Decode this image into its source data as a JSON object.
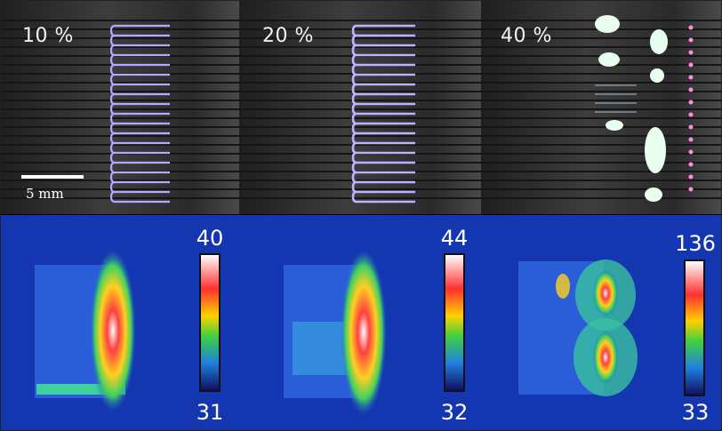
{
  "photos": {
    "percent_labels": [
      "10 %",
      "20 %",
      "40 %"
    ],
    "scale_bar_label": "5 mm"
  },
  "thermal": {
    "colorbars": [
      {
        "max": "40",
        "min": "31"
      },
      {
        "max": "44",
        "min": "32"
      },
      {
        "max": "136",
        "min": "33"
      }
    ]
  },
  "colors": {
    "plasma_glow": "#b8a6ff",
    "electrode_bg": "#3a3a3a",
    "thermal_bg": "#0d1a7a"
  }
}
